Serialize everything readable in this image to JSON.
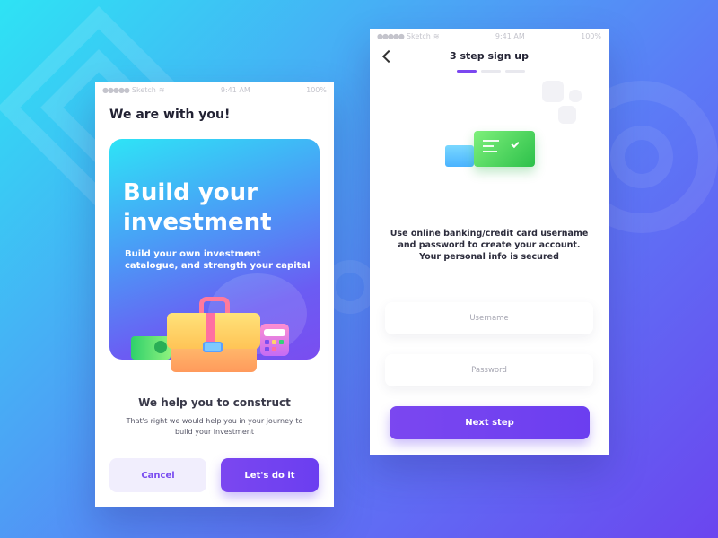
{
  "colors": {
    "accent": "#7B47F0",
    "bg_start": "#2EE3F4",
    "bg_end": "#6B45EF"
  },
  "status_bar": {
    "carrier": "Sketch",
    "time": "9:41 AM",
    "battery": "100%"
  },
  "screen1": {
    "title": "We are with you!",
    "hero_title": "Build your investment",
    "hero_subtitle": "Build your own investment catalogue, and strength your capital",
    "heading": "We help you to construct",
    "description": "That's right we would help you in your journey to build your investment",
    "cancel_label": "Cancel",
    "confirm_label": "Let's do it"
  },
  "screen2": {
    "title": "3 step sign up",
    "back_icon": "chevron-left-icon",
    "steps_total": 3,
    "current_step": 1,
    "description": "Use online banking/credit card username and password to create your account. Your personal info is secured",
    "username_placeholder": "Username",
    "password_placeholder": "Password",
    "next_label": "Next step"
  }
}
